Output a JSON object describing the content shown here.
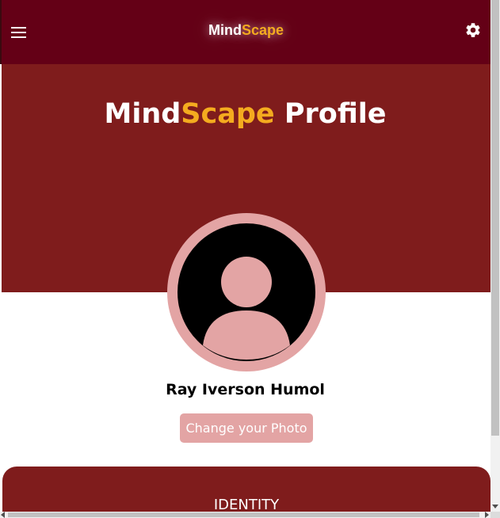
{
  "header": {
    "brand_main": "Mind",
    "brand_accent": "Scape",
    "menu_icon": "hamburger-menu-icon",
    "settings_icon": "gear-icon"
  },
  "hero": {
    "title_main": "Mind",
    "title_accent": "Scape",
    "title_rest": " Profile"
  },
  "profile": {
    "avatar_icon": "user-avatar-icon",
    "name": "Ray Iverson Humol",
    "change_photo_label": "Change your Photo"
  },
  "section": {
    "identity_label": "IDENTITY"
  },
  "colors": {
    "navbar": "#640016",
    "hero": "#7f1c1c",
    "accent": "#f4ab1f",
    "avatar_ring": "#e3a4a4",
    "button": "#e3a4a4"
  }
}
